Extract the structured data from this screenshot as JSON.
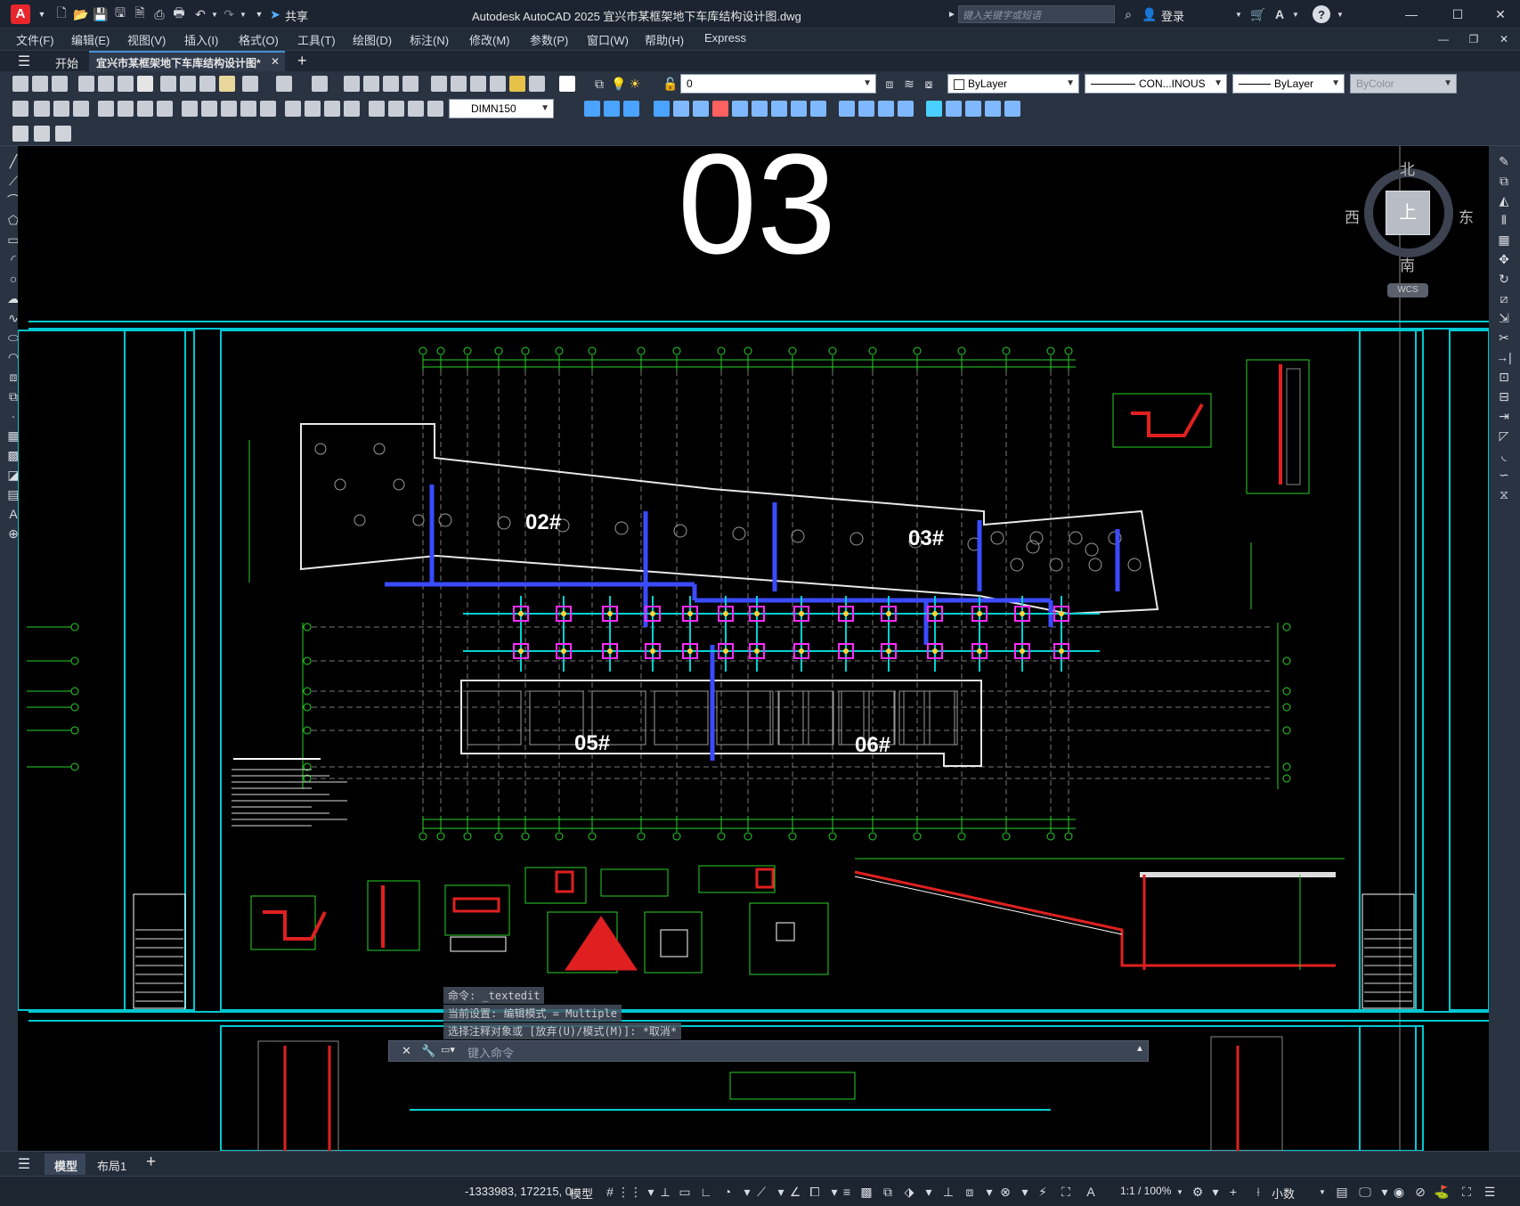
{
  "titlebar": {
    "app_badge": "A",
    "share": "共享",
    "title": "Autodesk AutoCAD 2025    宜兴市某框架地下车库结构设计图.dwg",
    "search_placeholder": "键入关键字或短语",
    "login": "登录"
  },
  "menu": [
    "文件(F)",
    "编辑(E)",
    "视图(V)",
    "插入(I)",
    "格式(O)",
    "工具(T)",
    "绘图(D)",
    "标注(N)",
    "修改(M)",
    "参数(P)",
    "窗口(W)",
    "帮助(H)",
    "Express"
  ],
  "tabs": {
    "start": "开始",
    "doc": "宜兴市某框架地下车库结构设计图*",
    "add": "+"
  },
  "toolbar": {
    "layer_value": "0",
    "color": "ByLayer",
    "linetype": "CON...INOUS",
    "lineweight": "ByLayer",
    "plotstyle": "ByColor",
    "dimstyle": "DIMN150"
  },
  "viewcube": {
    "north": "北",
    "south": "南",
    "east": "东",
    "west": "西",
    "top": "上",
    "wcs": "WCS"
  },
  "drawing": {
    "big_number": "03",
    "buildings": [
      "02#",
      "03#",
      "05#",
      "06#"
    ]
  },
  "command": {
    "line1": "命令: _textedit",
    "line2": "当前设置: 编辑模式 = Multiple",
    "line3": "选择注释对象或 [放弃(U)/模式(M)]: *取消*",
    "input_placeholder": "键入命令"
  },
  "layout_tabs": {
    "model": "模型",
    "layout1": "布局1",
    "add": "+"
  },
  "status": {
    "coords": "-1333983, 172215, 0",
    "model": "模型",
    "scale": "1:1 / 100%",
    "units": "小数"
  },
  "colors": {
    "accent_cyan": "#00c8d2",
    "grid_green": "#28d228",
    "red": "#e02020",
    "blue": "#3a4cff",
    "magenta": "#ff2cff"
  }
}
